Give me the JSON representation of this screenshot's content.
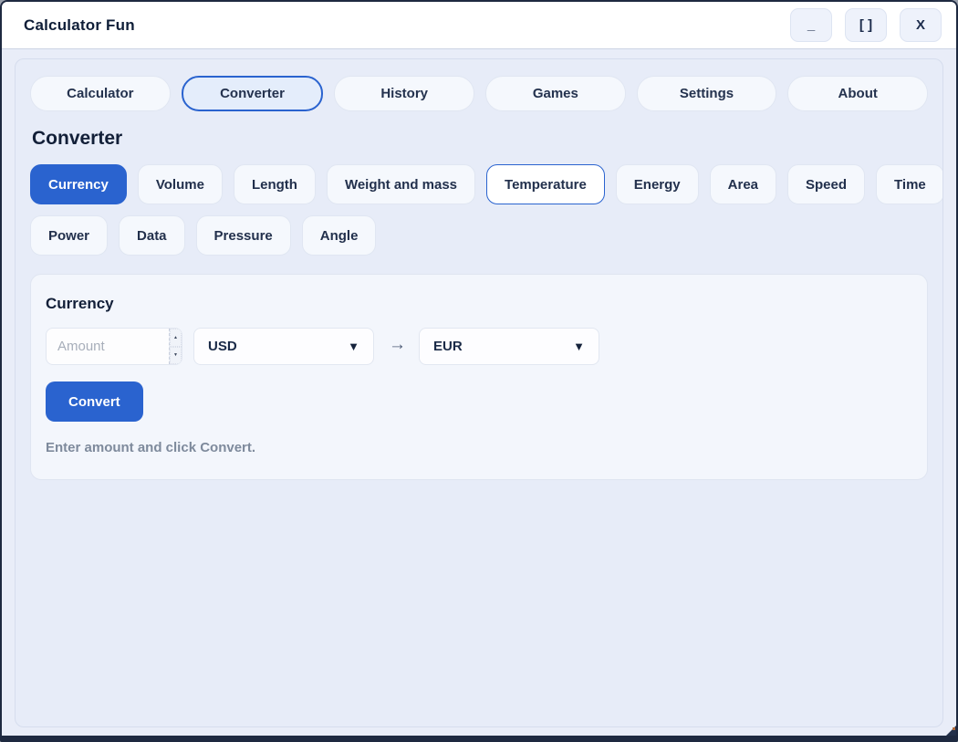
{
  "window": {
    "title": "Calculator Fun",
    "controls": {
      "minimize": "_",
      "maximize": "[ ]",
      "close": "X"
    }
  },
  "tabs": [
    {
      "label": "Calculator",
      "active": false
    },
    {
      "label": "Converter",
      "active": true
    },
    {
      "label": "History",
      "active": false
    },
    {
      "label": "Games",
      "active": false
    },
    {
      "label": "Settings",
      "active": false
    },
    {
      "label": "About",
      "active": false
    }
  ],
  "converter": {
    "heading": "Converter",
    "categories": [
      {
        "label": "Currency",
        "state": "selected"
      },
      {
        "label": "Volume",
        "state": "normal"
      },
      {
        "label": "Length",
        "state": "normal"
      },
      {
        "label": "Weight and mass",
        "state": "normal"
      },
      {
        "label": "Temperature",
        "state": "outlined"
      },
      {
        "label": "Energy",
        "state": "normal"
      },
      {
        "label": "Area",
        "state": "normal"
      },
      {
        "label": "Speed",
        "state": "normal"
      },
      {
        "label": "Time",
        "state": "normal"
      },
      {
        "label": "Power",
        "state": "normal"
      },
      {
        "label": "Data",
        "state": "normal"
      },
      {
        "label": "Pressure",
        "state": "normal"
      },
      {
        "label": "Angle",
        "state": "normal"
      }
    ],
    "panel": {
      "heading": "Currency",
      "amount_placeholder": "Amount",
      "amount_value": "",
      "from_currency": "USD",
      "to_currency": "EUR",
      "convert_label": "Convert",
      "status": "Enter amount and click Convert."
    }
  },
  "icons": {
    "dropdown_caret": "▼",
    "spin_up": "▲",
    "spin_down": "▼",
    "flow_arrow": "→"
  },
  "colors": {
    "accent": "#2a63cf",
    "window_border": "#1e2940",
    "container_bg": "#e7ecf8",
    "panel_bg": "#f3f6fc",
    "status_text": "#7e8a9c"
  }
}
